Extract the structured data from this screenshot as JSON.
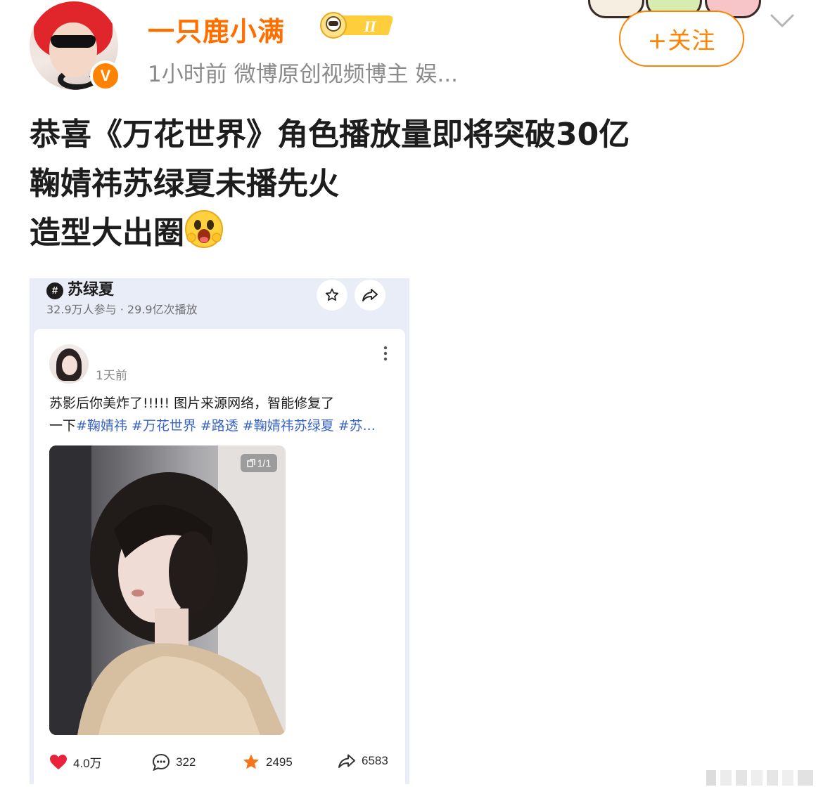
{
  "header": {
    "username": "一只鹿小满",
    "meta": "1小时前  微博原创视频博主 娱...",
    "follow_label": "+关注",
    "verified_badge": "V",
    "level_badge": "II"
  },
  "post": {
    "lines": [
      "恭喜《万花世界》角色播放量即将突破30亿",
      "鞠婧祎苏绿夏未播先火",
      "造型大出圈"
    ],
    "emoji": "surprised-face-emoji"
  },
  "embed": {
    "topic": {
      "hash_symbol": "#",
      "title": "苏绿夏",
      "stats": "32.9万人参与 · 29.9亿次播放"
    },
    "card": {
      "time": "1天前",
      "text_line1": "苏影后你美炸了!!!!!  图片来源网络，智能修复了",
      "text_line2_prefix": "一下",
      "hashtags": [
        "#鞠婧祎",
        "#万花世界",
        "#路透",
        "#鞠婧祎苏绿夏",
        "#苏..."
      ],
      "page_indicator": "1/1",
      "stats": {
        "likes": "4.0万",
        "comments": "322",
        "favorites": "2495",
        "shares": "6583"
      }
    }
  },
  "colors": {
    "accent": "#ff8200",
    "username": "#ff6f00",
    "hashtag": "#3a64c8",
    "like": "#e8233b",
    "favorite": "#f5761a"
  }
}
